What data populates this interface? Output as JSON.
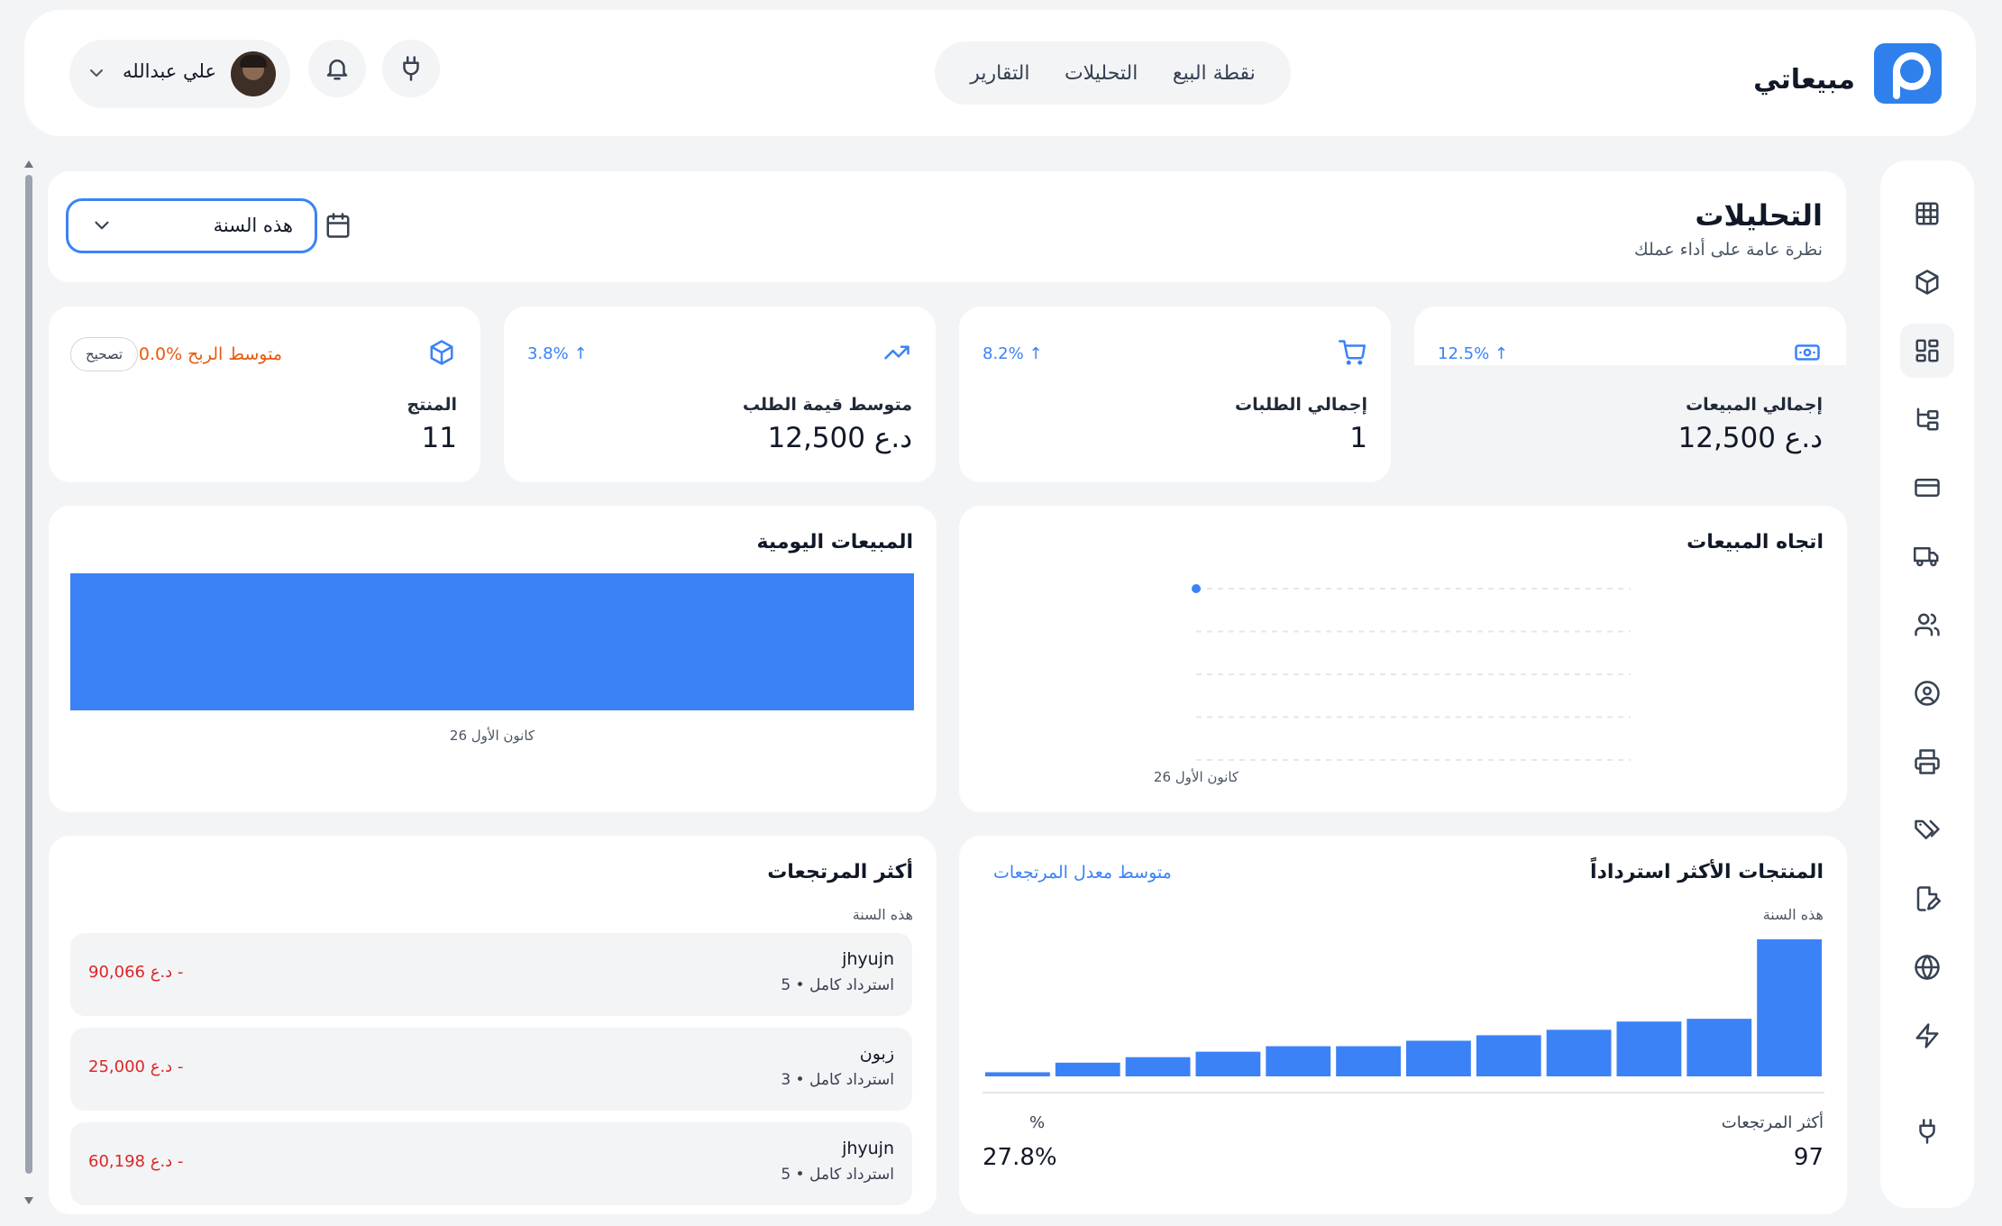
{
  "header": {
    "brand_name": "مبيعاتي",
    "nav": [
      "نقطة البيع",
      "التحليلات",
      "التقارير"
    ],
    "user_name": "علي عبدالله"
  },
  "page": {
    "title": "التحليلات",
    "subtitle": "نظرة عامة على أداء عملك",
    "period": "هذه السنة"
  },
  "stats": {
    "sales": {
      "label": "إجمالي المبيعات",
      "value": "د.ع 12,500",
      "trend": "12.5% ↑"
    },
    "orders": {
      "label": "إجمالي الطلبات",
      "value": "1",
      "trend": "8.2% ↑"
    },
    "aov": {
      "label": "متوسط قيمة الطلب",
      "value": "د.ع 12,500",
      "trend": "3.8% ↑"
    },
    "product": {
      "label": "المنتج",
      "value": "11",
      "profit_text": "متوسط الربح %0.0",
      "fix_label": "تصحيح"
    }
  },
  "sales_trend": {
    "title": "اتجاه المبيعات",
    "chart_data": {
      "type": "line",
      "x": [
        "كانون الأول 26"
      ],
      "series": [
        {
          "values": [
            12500
          ]
        }
      ],
      "grid": true
    }
  },
  "daily_sales": {
    "title": "المبيعات اليومية",
    "chart_data": {
      "type": "bar",
      "categories": [
        "كانون الأول 26"
      ],
      "values": [
        12500
      ]
    },
    "bar_color": "#3b82f6"
  },
  "top_refunded": {
    "title": "المنتجات الأكثر استرداداً",
    "subtitle": "هذه السنة",
    "link": "متوسط معدل المرتجعات",
    "chart_data": {
      "type": "bar",
      "values": [
        3,
        10,
        14,
        18,
        22,
        22,
        26,
        30,
        34,
        40,
        42,
        100
      ]
    },
    "foot_left_label": "أكثر المرتجعات",
    "foot_left_value": "97",
    "foot_right_label": "%",
    "foot_right_value": "27.8%"
  },
  "top_returns": {
    "title": "أكثر المرتجعات",
    "subtitle": "هذه السنة",
    "rows": [
      {
        "name": "jhyujn",
        "sub": "استرداد كامل • 5",
        "amount": "- د.ع 90,066"
      },
      {
        "name": "زبون",
        "sub": "استرداد كامل • 3",
        "amount": "- د.ع 25,000"
      },
      {
        "name": "jhyujn",
        "sub": "استرداد كامل • 5",
        "amount": "- د.ع 60,198"
      }
    ]
  },
  "sidebar": {
    "icons": [
      "grid-icon",
      "package-icon",
      "dashboard-icon",
      "hierarchy-icon",
      "card-icon",
      "truck-icon",
      "users-icon",
      "user-circle-icon",
      "printer-icon",
      "tags-icon",
      "file-edit-icon",
      "globe-icon",
      "zap-icon",
      "plug-icon"
    ]
  },
  "colors": {
    "accent": "#3b82f6",
    "warning": "#ea580c",
    "danger": "#dc2626"
  }
}
